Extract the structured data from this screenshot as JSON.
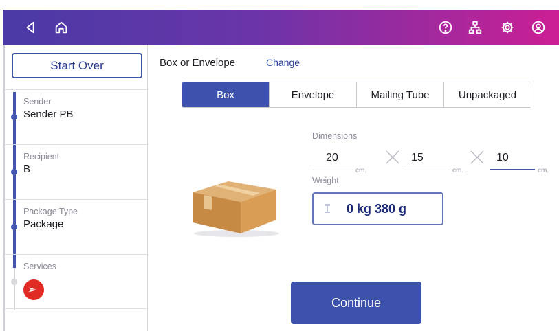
{
  "topbar": {
    "icons": [
      "back-icon",
      "home-icon",
      "help-icon",
      "network-icon",
      "settings-icon",
      "account-icon"
    ]
  },
  "sidebar": {
    "start_over_label": "Start Over",
    "steps": [
      {
        "label": "Sender",
        "value": "Sender PB"
      },
      {
        "label": "Recipient",
        "value": "B"
      },
      {
        "label": "Package Type",
        "value": "Package"
      },
      {
        "label": "Services",
        "value": ""
      }
    ]
  },
  "main": {
    "box_or_envelope_label": "Box or Envelope",
    "change_label": "Change",
    "package_types": [
      "Box",
      "Envelope",
      "Mailing Tube",
      "Unpackaged"
    ],
    "selected_package_type": "Box",
    "dimensions_label": "Dimensions",
    "dimensions": [
      {
        "value": "20",
        "unit": "cm."
      },
      {
        "value": "15",
        "unit": "cm."
      },
      {
        "value": "10",
        "unit": "cm."
      }
    ],
    "weight_label": "Weight",
    "weight_value": "0 kg 380 g",
    "continue_label": "Continue"
  },
  "colors": {
    "accent": "#3d52ad",
    "topbar_start": "#4a3aa6",
    "topbar_end": "#cc1e94",
    "carrier_red": "#e02a24"
  }
}
